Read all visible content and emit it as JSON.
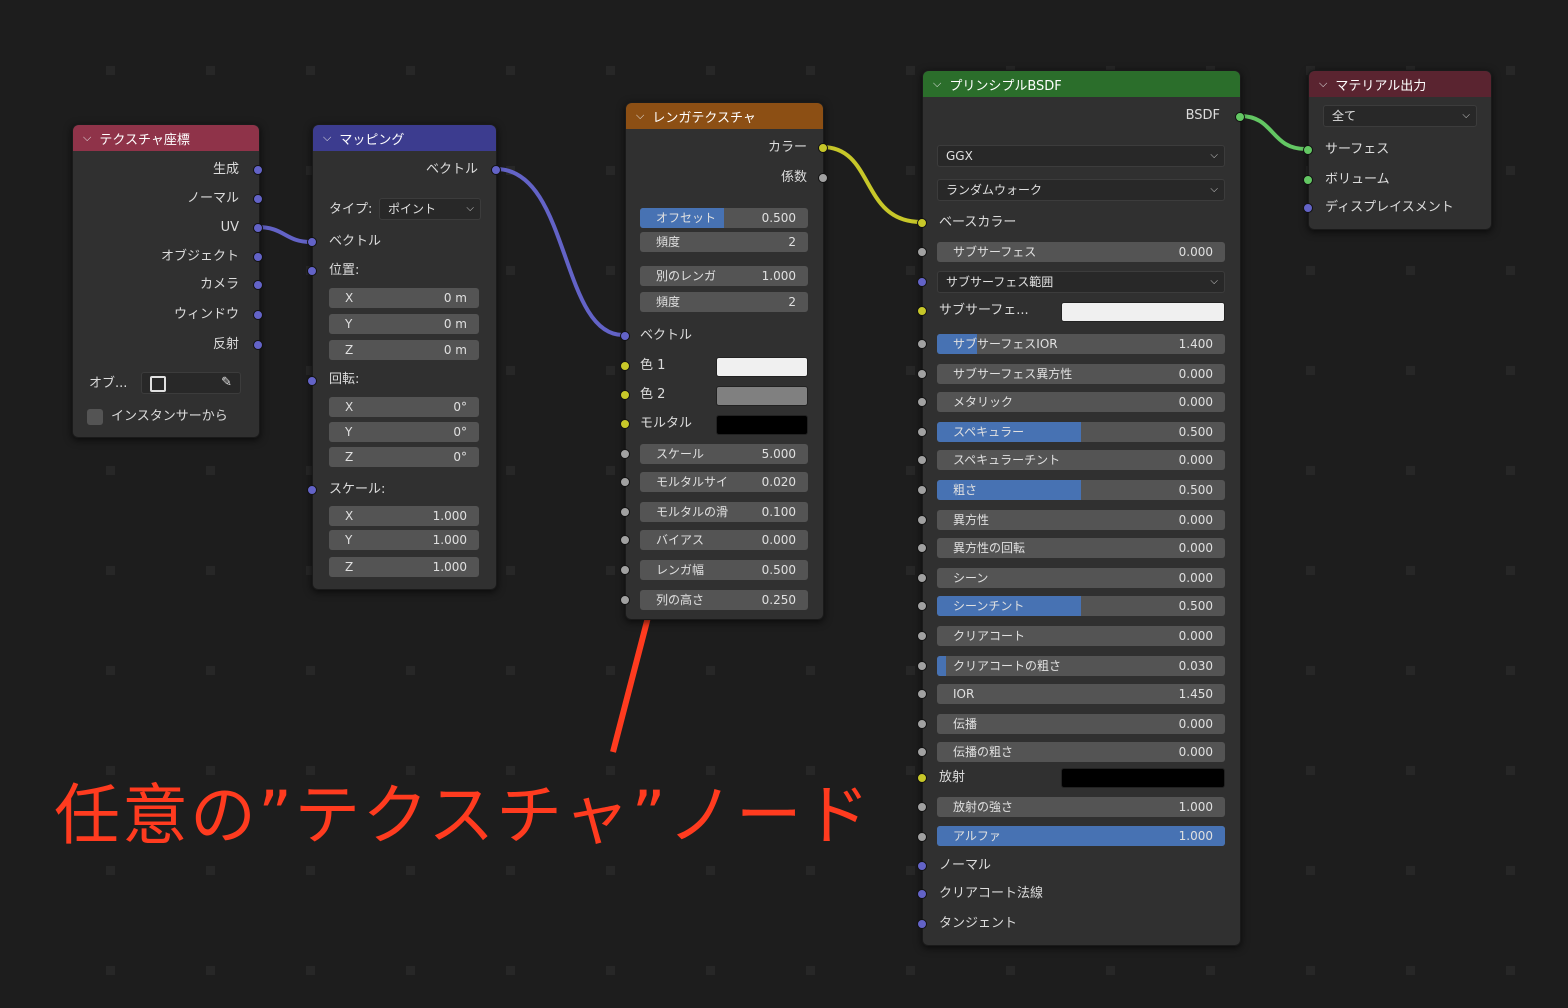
{
  "colors": {
    "background": "#1d1d1d",
    "node_body": "#303030",
    "header_texture_coord": "#8f3349",
    "header_mapping": "#3c3c8f",
    "header_brick": "#8c4f14",
    "header_bsdf": "#2b6e2b",
    "header_output": "#5a2430",
    "vector_socket": "#6363c7",
    "color_socket": "#c7c729",
    "float_socket": "#a1a1a1",
    "shader_socket": "#63c763",
    "slider_fill": "#4772b3",
    "annotation": "#ff3b1f"
  },
  "texture_coord": {
    "title": "テクスチャ座標",
    "outputs": [
      "生成",
      "ノーマル",
      "UV",
      "オブジェクト",
      "カメラ",
      "ウィンドウ",
      "反射"
    ],
    "object_label": "オブ...",
    "instancer_label": "インスタンサーから"
  },
  "mapping": {
    "title": "マッピング",
    "output": "ベクトル",
    "type_label": "タイプ:",
    "type_value": "ポイント",
    "vector_input": "ベクトル",
    "location_label": "位置:",
    "location": [
      {
        "axis": "X",
        "value": "0 m"
      },
      {
        "axis": "Y",
        "value": "0 m"
      },
      {
        "axis": "Z",
        "value": "0 m"
      }
    ],
    "rotation_label": "回転:",
    "rotation": [
      {
        "axis": "X",
        "value": "0°"
      },
      {
        "axis": "Y",
        "value": "0°"
      },
      {
        "axis": "Z",
        "value": "0°"
      }
    ],
    "scale_label": "スケール:",
    "scale": [
      {
        "axis": "X",
        "value": "1.000"
      },
      {
        "axis": "Y",
        "value": "1.000"
      },
      {
        "axis": "Z",
        "value": "1.000"
      }
    ]
  },
  "brick": {
    "title": "レンガテクスチャ",
    "out_color": "カラー",
    "out_fac": "係数",
    "offset": {
      "label": "オフセット",
      "value": "0.500",
      "fill": 0.5
    },
    "offset_freq": {
      "label": "頻度",
      "value": "2"
    },
    "squash": {
      "label": "別のレンガ",
      "value": "1.000"
    },
    "squash_freq": {
      "label": "頻度",
      "value": "2"
    },
    "vector_input": "ベクトル",
    "color1_label": "色 1",
    "color2_label": "色 2",
    "mortar_label": "モルタル",
    "color1": "#f0f0f0",
    "color2": "#808080",
    "mortar": "#000000",
    "inputs": [
      {
        "label": "スケール",
        "value": "5.000"
      },
      {
        "label": "モルタルサイ",
        "value": "0.020"
      },
      {
        "label": "モルタルの滑",
        "value": "0.100"
      },
      {
        "label": "バイアス",
        "value": "0.000"
      },
      {
        "label": "レンガ幅",
        "value": "0.500"
      },
      {
        "label": "列の高さ",
        "value": "0.250"
      }
    ]
  },
  "bsdf": {
    "title": "プリンシプルBSDF",
    "output": "BSDF",
    "distribution": "GGX",
    "subsurface_method": "ランダムウォーク",
    "base_color_label": "ベースカラー",
    "subsurface": {
      "label": "サブサーフェス",
      "value": "0.000"
    },
    "subsurface_radius": "サブサーフェス範囲",
    "subsurface_color_label": "サブサーフェ...",
    "subsurface_color": "#f0f0f0",
    "sliders": [
      {
        "label": "サブサーフェスIOR",
        "value": "1.400",
        "fill": 0.14
      },
      {
        "label": "サブサーフェス異方性",
        "value": "0.000",
        "fill": 0
      },
      {
        "label": "メタリック",
        "value": "0.000",
        "fill": 0
      },
      {
        "label": "スペキュラー",
        "value": "0.500",
        "fill": 0.5
      },
      {
        "label": "スペキュラーチント",
        "value": "0.000",
        "fill": 0
      },
      {
        "label": "粗さ",
        "value": "0.500",
        "fill": 0.5
      },
      {
        "label": "異方性",
        "value": "0.000",
        "fill": 0
      },
      {
        "label": "異方性の回転",
        "value": "0.000",
        "fill": 0
      },
      {
        "label": "シーン",
        "value": "0.000",
        "fill": 0
      },
      {
        "label": "シーンチント",
        "value": "0.500",
        "fill": 0.5
      },
      {
        "label": "クリアコート",
        "value": "0.000",
        "fill": 0
      },
      {
        "label": "クリアコートの粗さ",
        "value": "0.030",
        "fill": 0.03
      },
      {
        "label": "IOR",
        "value": "1.450",
        "fill": 0
      },
      {
        "label": "伝播",
        "value": "0.000",
        "fill": 0
      },
      {
        "label": "伝播の粗さ",
        "value": "0.000",
        "fill": 0
      }
    ],
    "emission_label": "放射",
    "emission_color": "#000000",
    "emission_strength": {
      "label": "放射の強さ",
      "value": "1.000",
      "fill": 0
    },
    "alpha": {
      "label": "アルファ",
      "value": "1.000",
      "fill": 1
    },
    "vector_inputs": [
      "ノーマル",
      "クリアコート法線",
      "タンジェント"
    ]
  },
  "output": {
    "title": "マテリアル出力",
    "target": "全て",
    "inputs": [
      "サーフェス",
      "ボリューム",
      "ディスプレイスメント"
    ]
  },
  "annotation": {
    "text": "任意の”テクスチャ”ノード"
  }
}
